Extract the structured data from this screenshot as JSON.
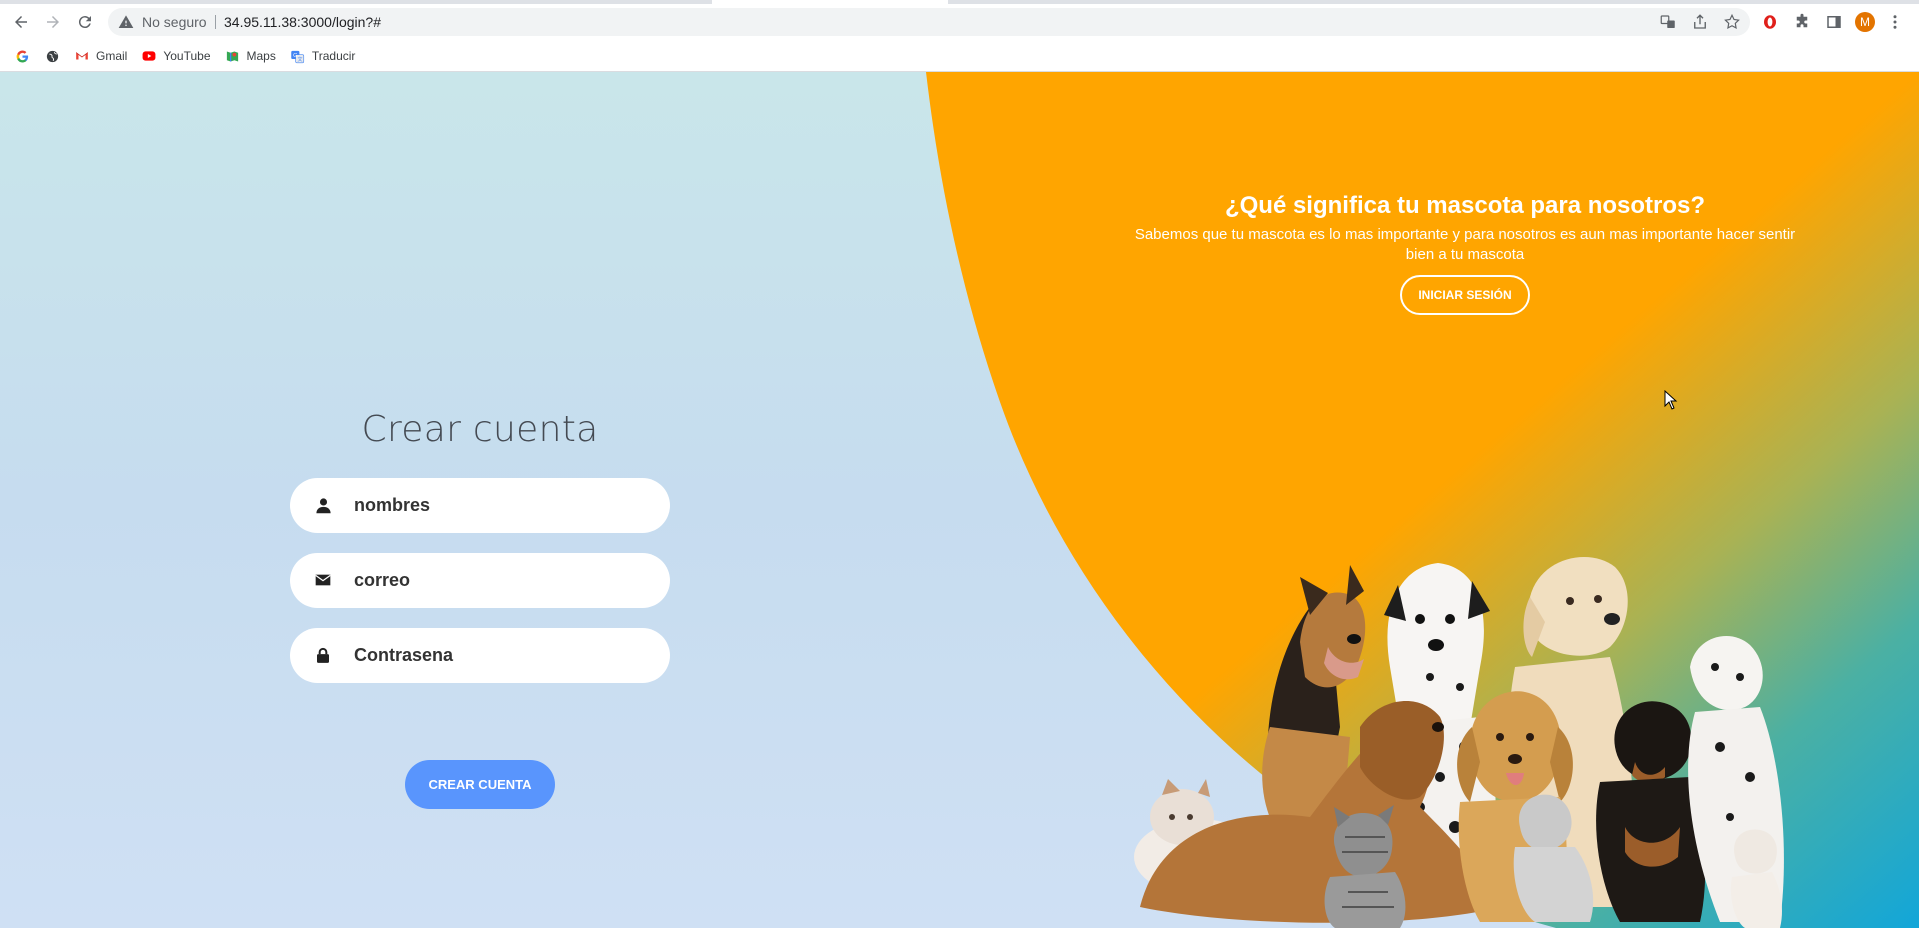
{
  "browser": {
    "address_status": "No seguro",
    "url": "34.95.11.38:3000/login?#",
    "avatar_initial": "M"
  },
  "bookmarks": [
    {
      "label": "",
      "icon": "google-icon"
    },
    {
      "label": "",
      "icon": "globe-icon"
    },
    {
      "label": "Gmail",
      "icon": "gmail-icon"
    },
    {
      "label": "YouTube",
      "icon": "youtube-icon"
    },
    {
      "label": "Maps",
      "icon": "maps-icon"
    },
    {
      "label": "Traducir",
      "icon": "translate-icon"
    }
  ],
  "signup": {
    "title": "Crear cuenta",
    "name_placeholder": "nombres",
    "email_placeholder": "correo",
    "password_placeholder": "Contrasena",
    "submit_label": "CREAR CUENTA"
  },
  "info": {
    "title": "¿Qué significa tu mascota para nosotros?",
    "text": "Sabemos que tu mascota es lo mas importante y para nosotros es aun mas importante hacer sentir bien a tu mascota",
    "login_label": "INICIAR SESIÓN"
  },
  "colors": {
    "orange": "#ffa500",
    "button_blue": "#5995fd",
    "teal": "#1ba9d8",
    "background_light": "#c9e6ea"
  }
}
